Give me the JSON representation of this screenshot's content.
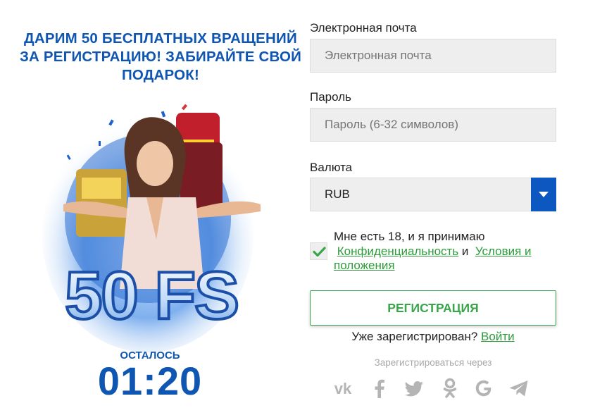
{
  "promo": {
    "title_lines": [
      "ДАРИМ 50 БЕСПЛАТНЫХ ВРАЩЕНИЙ",
      "ЗА РЕГИСТРАЦИЮ! ЗАБИРАЙТЕ СВОЙ",
      "ПОДАРОК!"
    ],
    "banner_text": "50 FS",
    "countdown_label": "ОСТАЛОСЬ",
    "countdown_value": "01:20"
  },
  "form": {
    "email_label": "Электронная почта",
    "email_placeholder": "Электронная почта",
    "password_label": "Пароль",
    "password_placeholder": "Пароль (6-32 символов)",
    "currency_label": "Валюта",
    "currency_value": "RUB",
    "consent_text": "Мне есть 18, и я принимаю",
    "privacy_link": "Конфиденциальность",
    "and_text": "и",
    "terms_link": "Условия и положения",
    "consent_checked": true,
    "register_button": "РЕГИСТРАЦИЯ",
    "already_registered": "Уже зарегистрирован?",
    "login_link": "Войти",
    "social_title": "Зарегистрироваться через",
    "social_icons": [
      "vk-icon",
      "facebook-icon",
      "twitter-icon",
      "odnoklassniki-icon",
      "google-icon",
      "telegram-icon"
    ]
  },
  "colors": {
    "brand_blue": "#0f56b3",
    "accent_green": "#39a54a",
    "social_gray": "#b4b4b4"
  }
}
